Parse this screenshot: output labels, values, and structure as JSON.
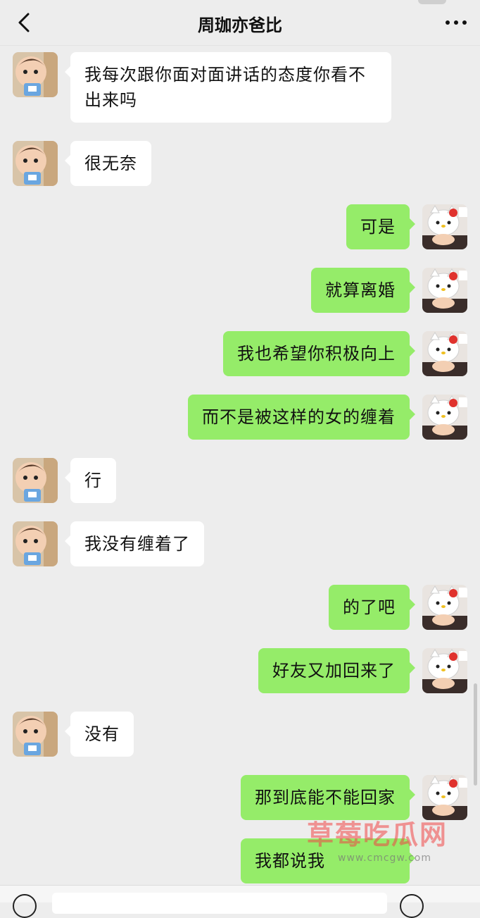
{
  "header": {
    "title": "周珈亦爸比"
  },
  "messages": [
    {
      "side": "left",
      "text": "我每次跟你面对面讲话的态度你看不出来吗"
    },
    {
      "side": "left",
      "text": "很无奈"
    },
    {
      "side": "right",
      "text": "可是"
    },
    {
      "side": "right",
      "text": "就算离婚"
    },
    {
      "side": "right",
      "text": "我也希望你积极向上"
    },
    {
      "side": "right",
      "text": "而不是被这样的女的缠着"
    },
    {
      "side": "left",
      "text": "行"
    },
    {
      "side": "left",
      "text": "我没有缠着了"
    },
    {
      "side": "right",
      "text": "的了吧"
    },
    {
      "side": "right",
      "text": "好友又加回来了"
    },
    {
      "side": "left",
      "text": "没有"
    },
    {
      "side": "right",
      "text": "那到底能不能回家"
    },
    {
      "side": "right",
      "text": "我都说我"
    }
  ],
  "watermark": {
    "main": "草莓吃瓜网",
    "sub": "www.cmcgw.com"
  },
  "colors": {
    "background": "#ededed",
    "self_bubble": "#95ec69",
    "other_bubble": "#ffffff"
  },
  "icons": {
    "back": "chevron-left-icon",
    "more": "more-dots-icon",
    "avatar_left": "baby-avatar-icon",
    "avatar_right": "hello-kitty-avatar-icon"
  }
}
